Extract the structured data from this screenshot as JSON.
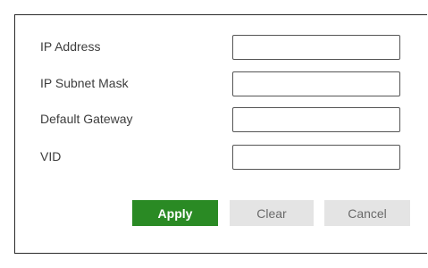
{
  "form": {
    "fields": [
      {
        "label": "IP Address",
        "value": ""
      },
      {
        "label": "IP Subnet Mask",
        "value": ""
      },
      {
        "label": "Default Gateway",
        "value": ""
      },
      {
        "label": "VID",
        "value": ""
      }
    ]
  },
  "buttons": {
    "apply_label": "Apply",
    "clear_label": "Clear",
    "cancel_label": "Cancel"
  },
  "colors": {
    "apply_bg": "#2a8a24",
    "secondary_bg": "#e4e4e4",
    "border": "#2a2a2a"
  }
}
